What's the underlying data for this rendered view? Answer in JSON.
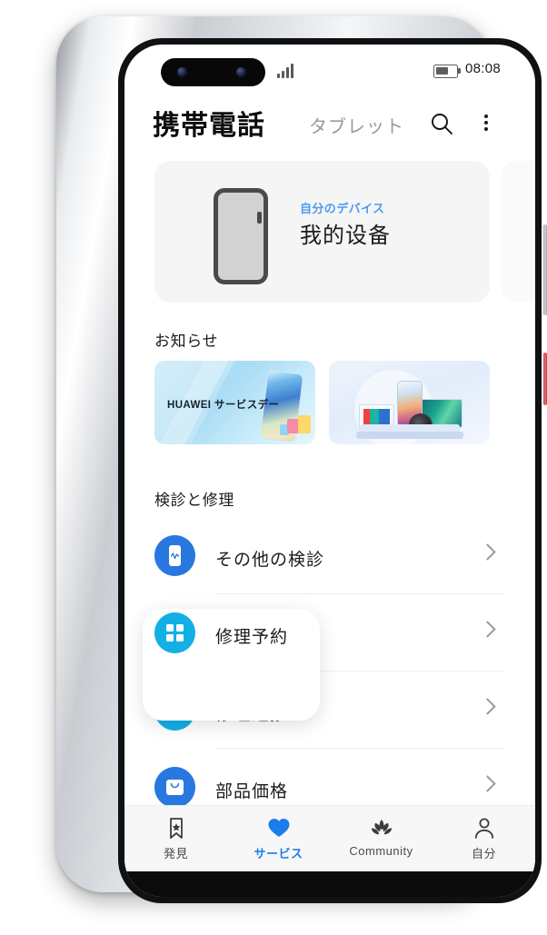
{
  "status_bar": {
    "time": "08:08",
    "signal_icon": "signal-bars-icon",
    "battery_icon": "battery-icon"
  },
  "header": {
    "tab_mobile": "携帯電話",
    "tab_tablet": "タブレット",
    "search_icon": "search-icon",
    "overflow_icon": "overflow-menu-icon"
  },
  "device_card": {
    "subtitle": "自分のデバイス",
    "title": "我的设备",
    "device_icon": "phone-outline-icon"
  },
  "notices": {
    "section_title": "お知らせ",
    "banners": [
      {
        "id": "service-day",
        "text": "HUAWEI サービスデー"
      },
      {
        "id": "products",
        "text": ""
      }
    ]
  },
  "repair": {
    "section_title": "検診と修理",
    "items": [
      {
        "label": "その他の検診",
        "icon": "phone-diagnostic-icon",
        "color": "#2878e0"
      },
      {
        "label": "修理予約",
        "icon": "grid-squares-icon",
        "color": "#13b0e6"
      },
      {
        "label": "修理進捗",
        "icon": "wrench-icon",
        "color": "#13b0e6"
      },
      {
        "label": "部品価格",
        "icon": "shopping-bag-icon",
        "color": "#2878e0"
      }
    ],
    "chevron_icon": "chevron-right-icon",
    "highlighted_item": "修理予約"
  },
  "bottom_nav": {
    "active": "サービス",
    "active_color": "#1b7ceb",
    "items": [
      {
        "label": "発見",
        "icon": "bookmark-star-icon"
      },
      {
        "label": "サービス",
        "icon": "heart-icon"
      },
      {
        "label": "Community",
        "icon": "lotus-icon"
      },
      {
        "label": "自分",
        "icon": "person-icon"
      }
    ]
  }
}
